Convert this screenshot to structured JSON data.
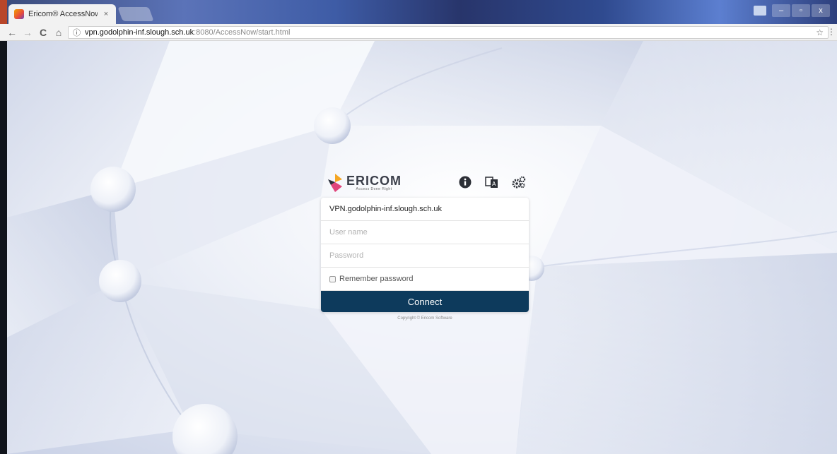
{
  "browser": {
    "tab_title": "Ericom® AccessNow™",
    "tab_close": "×",
    "url_host": "vpn.godolphin-inf.slough.sch.uk",
    "url_rest": ":8080/AccessNow/start.html",
    "back_icon": "←",
    "forward_icon": "→",
    "reload_icon": "C",
    "home_icon": "⌂",
    "info_icon": "ⓘ",
    "star_icon": "☆",
    "menu_icon": "⋮",
    "minimize": "–",
    "maximize": "▫",
    "close": "x"
  },
  "login": {
    "logo_name": "ERICOM",
    "logo_tagline": "Access Done Right",
    "server": "VPN.godolphin-inf.slough.sch.uk",
    "username_placeholder": "User name",
    "password_placeholder": "Password",
    "remember_label": "Remember password",
    "connect_label": "Connect",
    "copyright": "Copyright © Ericom Software"
  },
  "colors": {
    "connect_bg": "#0d3a5c",
    "logo_orange": "#f5a623",
    "logo_pink": "#e0457b",
    "logo_dark": "#2a2f3a"
  }
}
